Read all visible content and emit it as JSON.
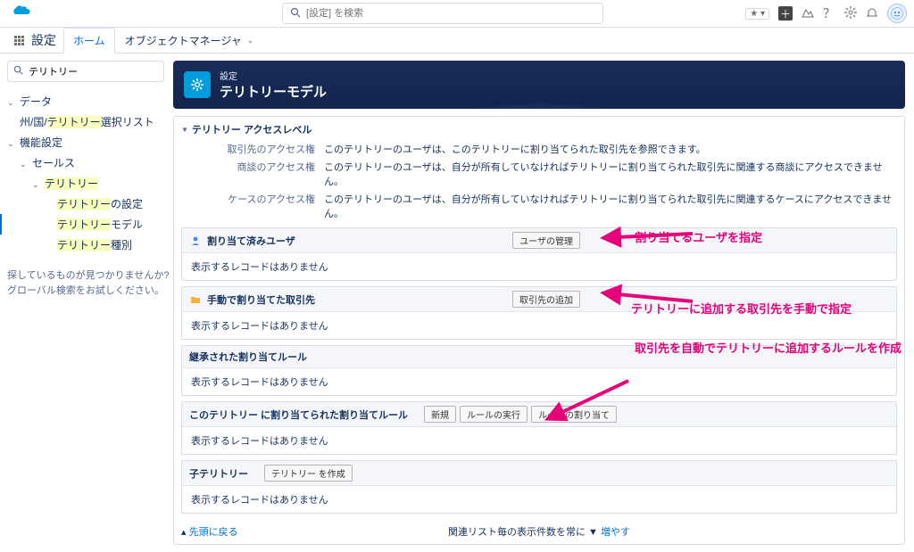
{
  "header": {
    "search_placeholder": "[設定] を検索",
    "app_name": "設定",
    "tabs": {
      "home": "ホーム",
      "object_manager": "オブジェクトマネージャ"
    }
  },
  "sidebar": {
    "quickfind_value": "テリトリー",
    "data": "データ",
    "picklist_prefix": "州/国/",
    "picklist_mark": "テリトリー",
    "picklist_suffix": "選択リスト",
    "feature": "機能設定",
    "sales": "セールス",
    "territory": "テリトリー",
    "territory_settings_mark": "テリトリー",
    "territory_settings_suffix": "の設定",
    "territory_model_mark": "テリトリー",
    "territory_model_suffix": "モデル",
    "territory_type_mark": "テリトリー",
    "territory_type_suffix": "種別",
    "hint1": "探しているものが見つかりませんか?",
    "hint2": "グローバル検索をお試しください。"
  },
  "page": {
    "supertitle": "設定",
    "title": "テリトリーモデル",
    "section_title": "テリトリー アクセスレベル",
    "access": {
      "account_label": "取引先のアクセス権",
      "account_value": "このテリトリーのユーザは、このテリトリーに割り当てられた取引先を参照できます。",
      "oppty_label": "商談のアクセス権",
      "oppty_value": "このテリトリーのユーザは、自分が所有していなければテリトリーに割り当てられた取引先に関連する商談にアクセスできません。",
      "case_label": "ケースのアクセス権",
      "case_value": "このテリトリーのユーザは、自分が所有していなければテリトリーに割り当てられた取引先に関連するケースにアクセスできません。"
    },
    "blocks": {
      "users": {
        "title": "割り当て済みユーザ",
        "btn": "ユーザの管理",
        "body": "表示するレコードはありません"
      },
      "accounts": {
        "title": "手動で割り当てた取引先",
        "btn": "取引先の追加",
        "body": "表示するレコードはありません"
      },
      "inherited": {
        "title": "継承された割り当てルール",
        "body": "表示するレコードはありません"
      },
      "rules": {
        "title": "このテリトリー に割り当てられた割り当てルール",
        "btn1": "新規",
        "btn2": "ルールの実行",
        "btn3": "ルールの割り当て",
        "body": "表示するレコードはありません"
      },
      "child": {
        "title": "子テリトリー",
        "btn": "テリトリー を作成",
        "body": "表示するレコードはありません"
      }
    },
    "back_link": "先頭に戻る",
    "footer_text": "関連リスト毎の表示件数を常に ",
    "footer_link": "増やす"
  },
  "annotations": {
    "a1": "割り当てるユーザを指定",
    "a2": "テリトリーに追加する取引先を手動で指定",
    "a3": "取引先を自動でテリトリーに追加するルールを作成"
  }
}
